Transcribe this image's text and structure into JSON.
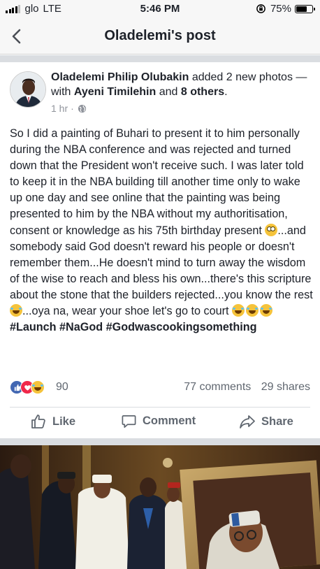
{
  "status_bar": {
    "carrier": "glo",
    "network": "LTE",
    "time": "5:46 PM",
    "battery": "75%",
    "battery_level": 0.75
  },
  "nav": {
    "title": "Oladelemi's post",
    "back_icon": "chevron-left-icon"
  },
  "post": {
    "author": "Oladelemi Philip Olubakin",
    "action_text": " added 2 new photos — with ",
    "tagged_person": "Ayeni Timilehin",
    "and_text": " and ",
    "others": "8 others",
    "end_text": ".",
    "time": "1 hr",
    "dot": "·",
    "text_part1": "So I did a painting of Buhari to present it to him personally during the NBA conference and was rejected and turned down that the President won't receive such. I was later told to keep it in the NBA building till another time only to wake up one day and see online that the painting was being presented to him by the NBA without my authoritisation, consent or knowledge as his 75th birthday present ",
    "text_part2": "...and somebody said God doesn't reward his people or doesn't remember them...He doesn't mind to turn away the wisdom of the wise to reach and bless his own...there's this scripture about the stone that the builders rejected...you know the rest",
    "text_part3": "...oya na, wear your shoe let's go to court ",
    "hashtags": "#Launch #NaGod #Godwascookingsomething"
  },
  "reactions": {
    "count": "90",
    "comments": "77 comments",
    "shares": "29 shares"
  },
  "actions": {
    "like": "Like",
    "comment": "Comment",
    "share": "Share"
  },
  "colors": {
    "brand_blue": "#4267b2",
    "text": "#1d2129",
    "meta": "#90949c",
    "muted": "#606770",
    "separator": "#dadde1"
  }
}
